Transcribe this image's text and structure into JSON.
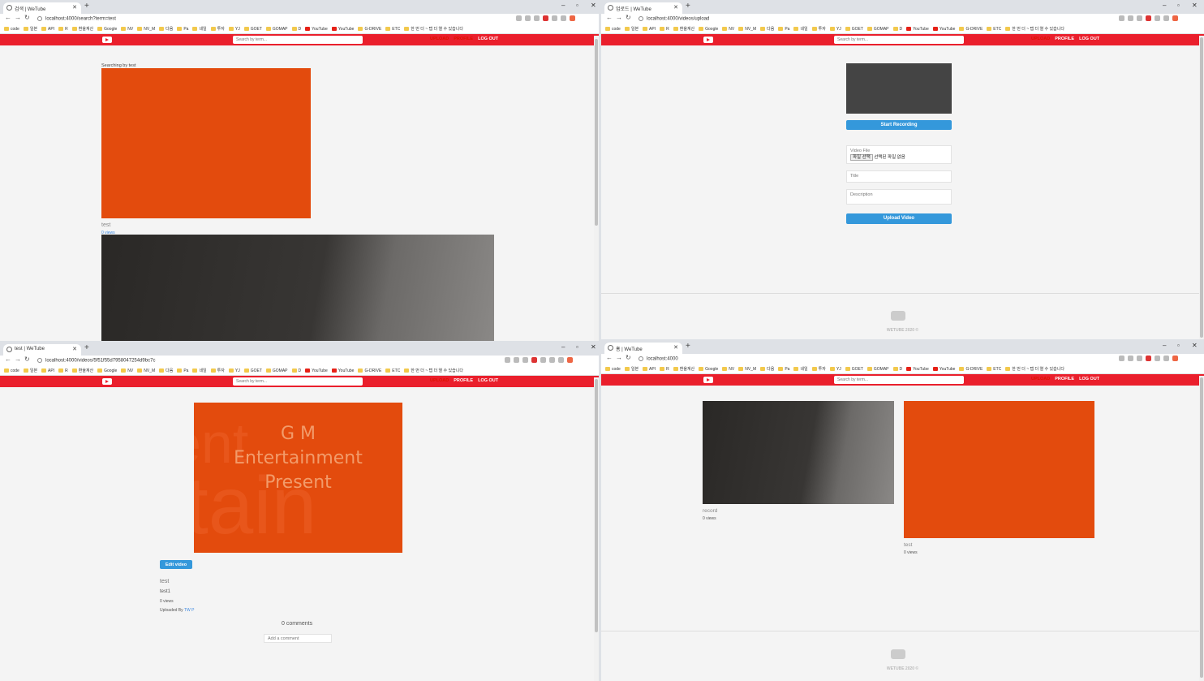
{
  "browser": {
    "bookmarks": [
      "code",
      "일본",
      "API",
      "R",
      "환율계산",
      "Google",
      "NV",
      "NV_M",
      "다음",
      "Pa",
      "네일",
      "투자",
      "YJ",
      "GOET",
      "GOMAP",
      "D",
      "YouTube",
      "YouTube",
      "G-DRIVE",
      "ETC",
      "한 번 더 ~ 탭 더 열 수 있습니다"
    ],
    "new_tab": "+",
    "close": "✕",
    "minimize": "–",
    "maximize": "▫",
    "back": "←",
    "forward": "→",
    "reload": "↻"
  },
  "header": {
    "search_placeholder": "Search by term...",
    "upload": "UPLOAD",
    "profile": "PROFILE",
    "logout": "LOG OUT"
  },
  "win1": {
    "tab_title": "검색 | WeTube",
    "url": "localhost:4000/search?term=test",
    "searching_text": "Searching by test",
    "video1": {
      "title": "test",
      "views": "0 views"
    }
  },
  "win2": {
    "tab_title": "업로드 | WeTube",
    "url": "localhost:4000/videos/upload",
    "start_recording": "Start Recording",
    "video_file_label": "Video File",
    "choose_file": "파일 선택",
    "no_file": "선택된 파일 없음",
    "title_placeholder": "Title",
    "description_placeholder": "Description",
    "upload_video": "Upload Video",
    "footer": "WETUBE 2020 ©"
  },
  "win3": {
    "tab_title": "test | WeTube",
    "url": "localhost:4000/videos/5f51f55d7958047254d9bc7c",
    "video_text": [
      "G M",
      "Entertainment",
      "Present"
    ],
    "edit_video": "Edit video",
    "title": "test",
    "description": "test1",
    "views": "0 views",
    "uploaded_by": "Uploaded By",
    "uploader": "TW P",
    "comments_count": "0 comments",
    "comment_placeholder": "Add a comment"
  },
  "win4": {
    "tab_title": "홈 | WeTube",
    "url": "localhost:4000",
    "videos": [
      {
        "title": "record",
        "views": "0 views"
      },
      {
        "title": "test",
        "views": "0 views"
      }
    ],
    "footer": "WETUBE 2020 ©"
  }
}
